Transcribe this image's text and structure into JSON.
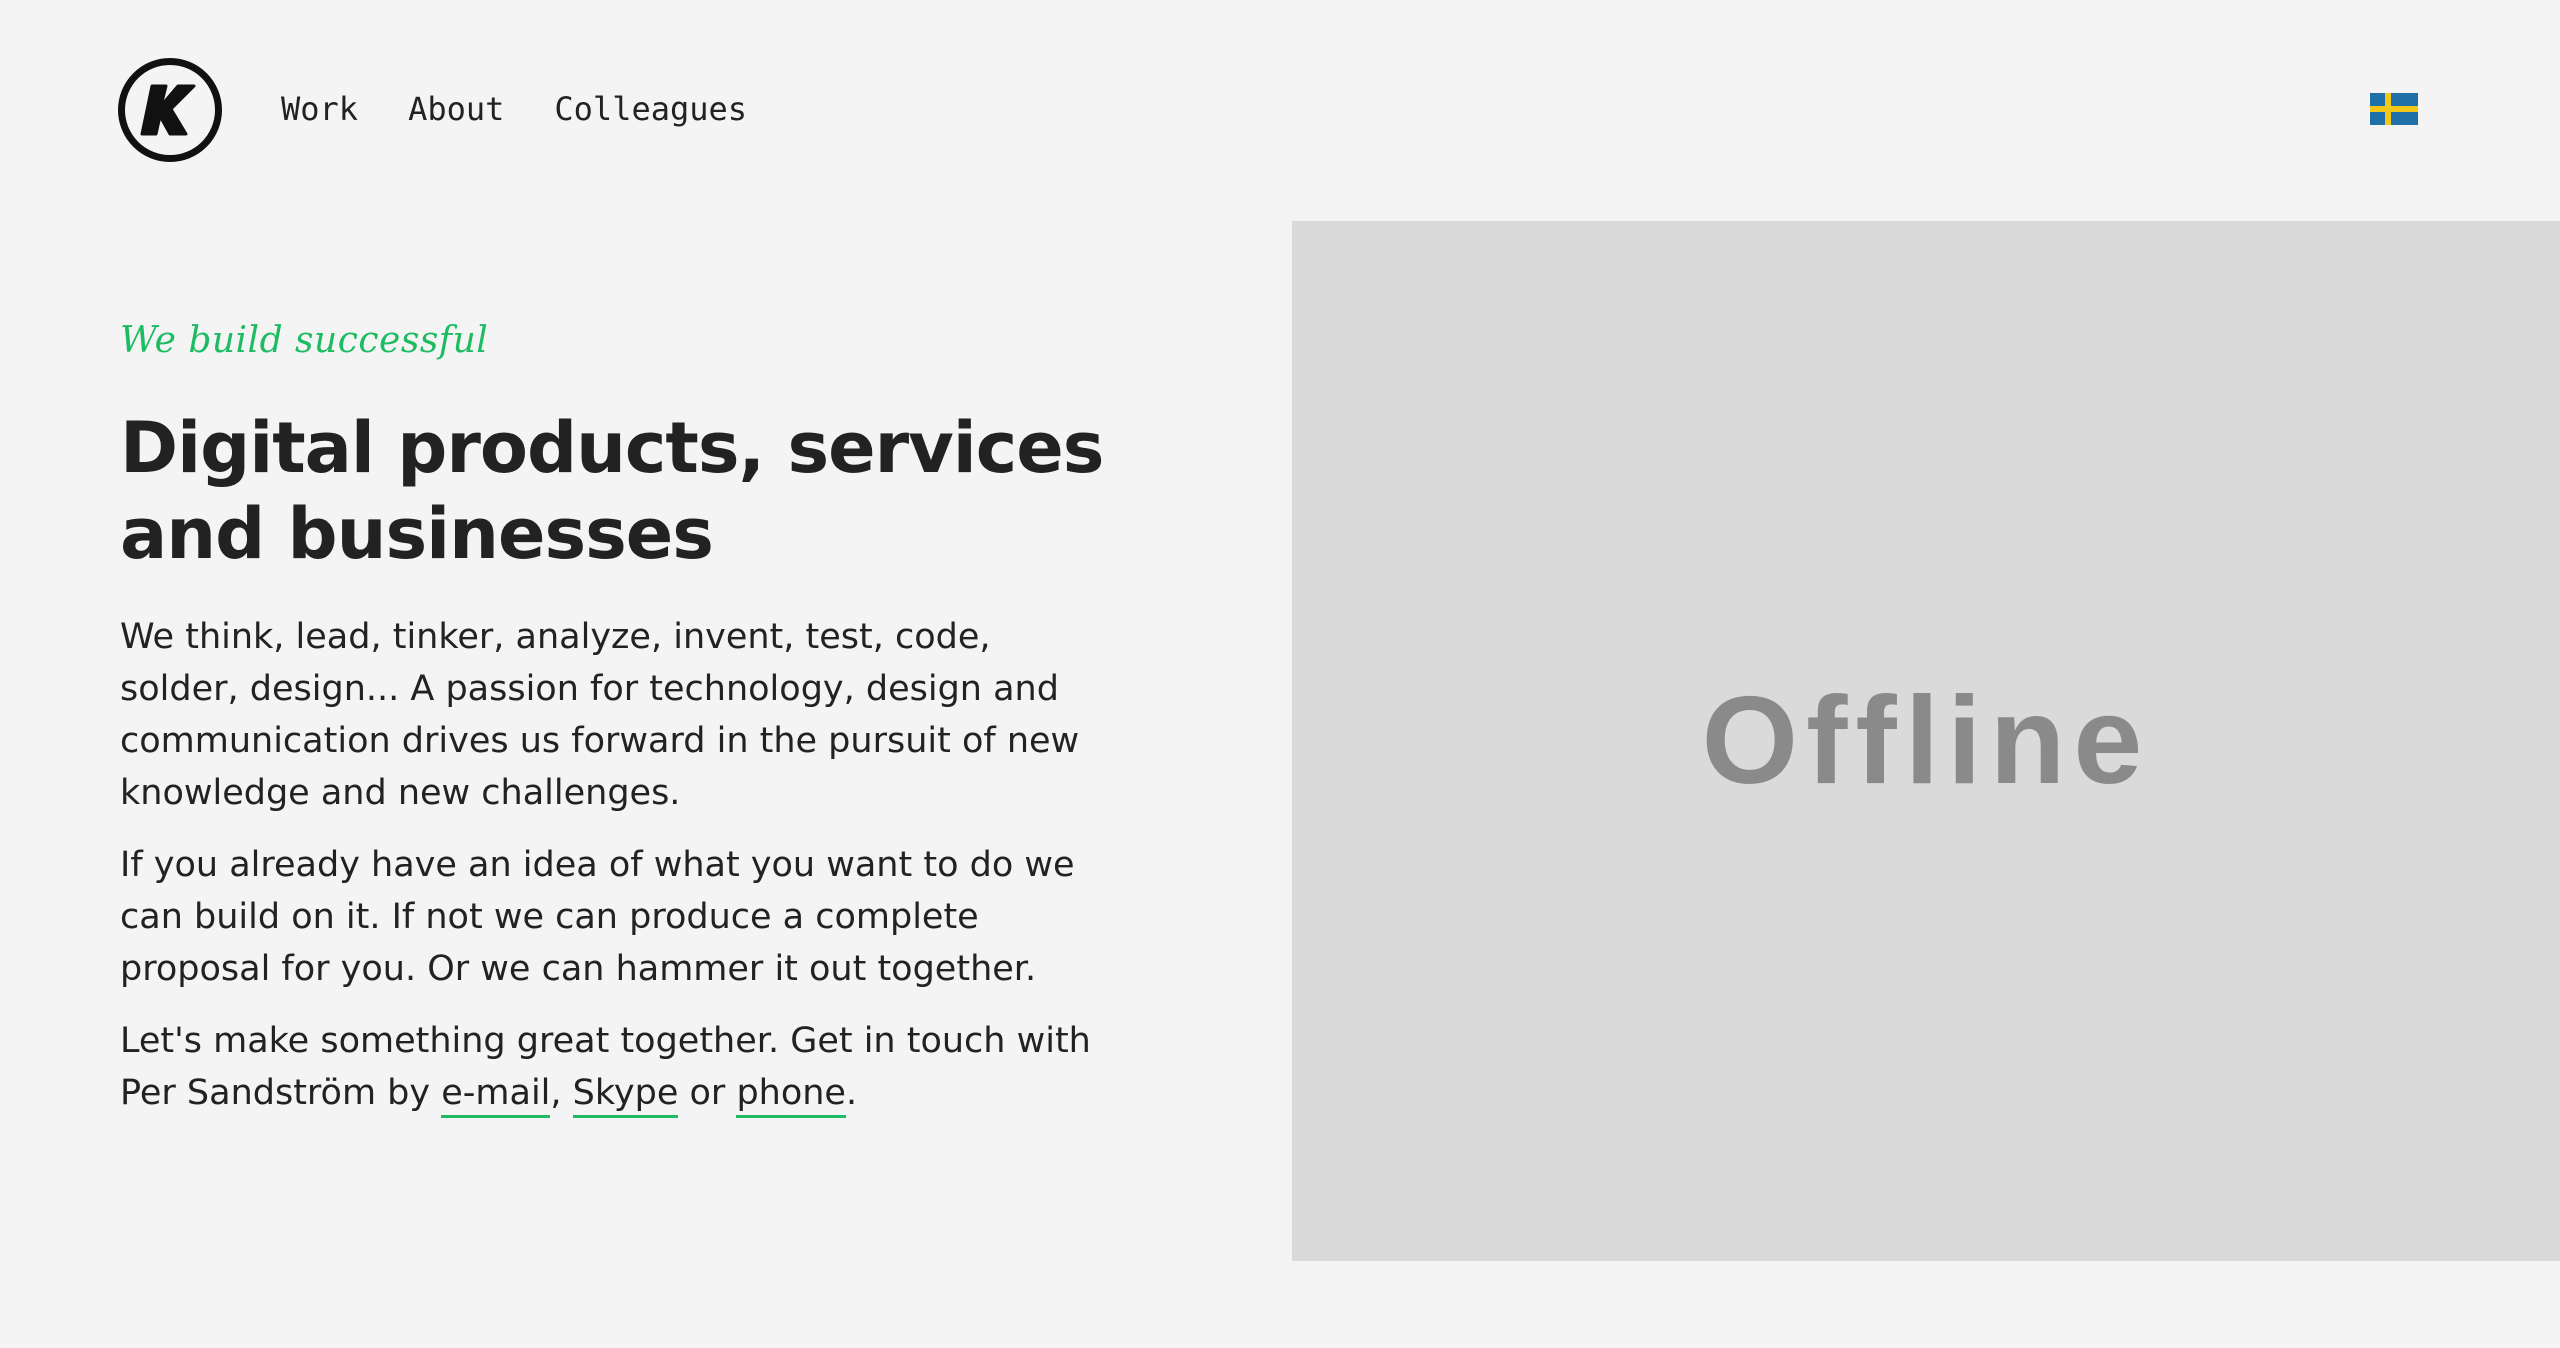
{
  "header": {
    "logo_icon": "k-logo-icon",
    "nav": [
      {
        "label": "Work"
      },
      {
        "label": "About"
      },
      {
        "label": "Colleagues"
      }
    ],
    "language_icon": "swedish-flag-icon"
  },
  "hero": {
    "tagline": "We build successful",
    "headline": "Digital products, services and businesses",
    "paragraph_1": "We think, lead, tinker, analyze, invent, test, code, solder, design... A passion for technology, design and communication drives us forward in the pursuit of new knowledge and new challenges.",
    "paragraph_2": "If you already have an idea of what you want to do we can build on it. If not we can produce a complete proposal for you. Or we can hammer it out together.",
    "paragraph_3": {
      "prefix": "Let's make something great together. Get in touch with Per Sandström by ",
      "email_link": "e-mail",
      "sep_1": ", ",
      "skype_link": "Skype",
      "sep_2": " or ",
      "phone_link": "phone",
      "suffix": "."
    }
  },
  "media": {
    "status_text": "Offline"
  },
  "colors": {
    "background": "#f4f4f4",
    "accent_green": "#1ebc62",
    "text": "#222222",
    "panel": "#dadada",
    "offline_text": "#8a8a8a",
    "flag_blue": "#1f6fa8",
    "flag_yellow": "#f2c719"
  }
}
